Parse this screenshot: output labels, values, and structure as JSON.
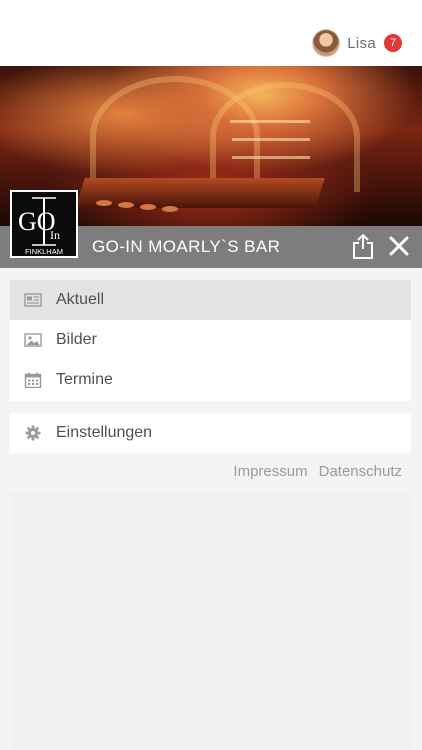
{
  "header": {
    "user_name": "Lisa",
    "notification_count": "7"
  },
  "venue": {
    "title": "GO-IN  MOARLY`S BAR",
    "logo_text_main": "GO",
    "logo_text_small": "In",
    "logo_subtext": "FINKLHAM"
  },
  "menu": {
    "primary": [
      {
        "label": "Aktuell",
        "icon": "newspaper-icon",
        "active": true
      },
      {
        "label": "Bilder",
        "icon": "image-icon",
        "active": false
      },
      {
        "label": "Termine",
        "icon": "calendar-icon",
        "active": false
      }
    ],
    "secondary": [
      {
        "label": "Einstellungen",
        "icon": "gear-icon",
        "active": false
      }
    ]
  },
  "footer": {
    "impressum": "Impressum",
    "datenschutz": "Datenschutz"
  },
  "colors": {
    "badge": "#e53636",
    "title_strip": "#787878",
    "active_item": "#e3e3e3",
    "page_bg": "#f4f4f4"
  }
}
